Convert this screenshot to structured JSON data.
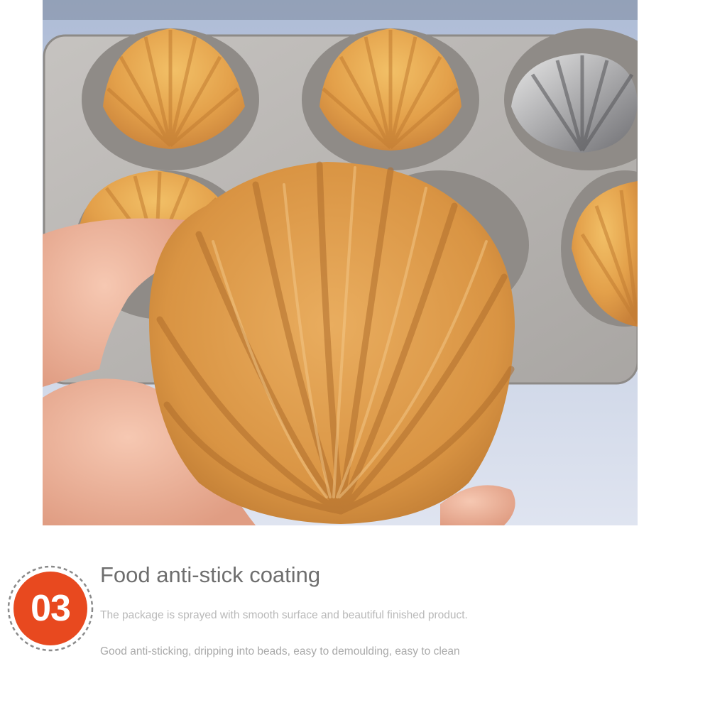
{
  "photo": {
    "subject": "madeleine-cake",
    "colors": {
      "cake": "#e2a04a",
      "tray": "#b9b6b3",
      "skin": "#f2b8a0",
      "backdrop": "#c9d3e6"
    }
  },
  "feature": {
    "badge_number": "03",
    "badge_color": "#e8491f",
    "title": "Food anti-stick coating",
    "description_1": "The package is sprayed with smooth surface and beautiful finished product.",
    "description_2": "Good anti-sticking, dripping into beads, easy to demoulding, easy to clean"
  }
}
